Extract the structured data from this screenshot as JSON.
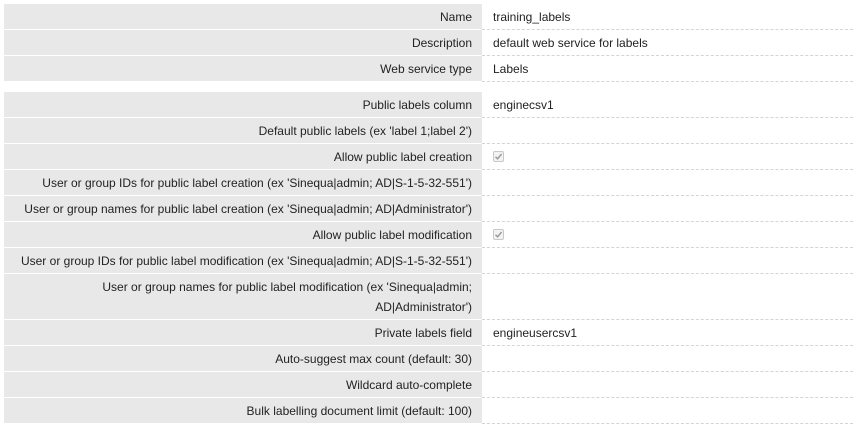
{
  "general": [
    {
      "label": "Name",
      "value": "training_labels"
    },
    {
      "label": "Description",
      "value": "default web service for labels"
    },
    {
      "label": "Web service type",
      "value": "Labels"
    }
  ],
  "settings": [
    {
      "label": "Public labels column",
      "value": "enginecsv1"
    },
    {
      "label": "Default public labels (ex 'label 1;label 2')",
      "value": ""
    },
    {
      "label": "Allow public label creation",
      "checked": true
    },
    {
      "label": "User or group IDs for public label creation (ex 'Sinequa|admin; AD|S-1-5-32-551')",
      "value": ""
    },
    {
      "label": "User or group names for public label creation (ex 'Sinequa|admin; AD|Administrator')",
      "value": ""
    },
    {
      "label": "Allow public label modification",
      "checked": true
    },
    {
      "label": "User or group IDs for public label modification (ex 'Sinequa|admin; AD|S-1-5-32-551')",
      "value": ""
    },
    {
      "label": "User or group names for public label modification (ex 'Sinequa|admin; AD|Administrator')",
      "value": ""
    },
    {
      "label": "Private labels field",
      "value": "engineusercsv1"
    },
    {
      "label": "Auto-suggest max count (default: 30)",
      "value": ""
    },
    {
      "label": "Wildcard auto-complete",
      "value": ""
    },
    {
      "label": "Bulk labelling document limit (default: 100)",
      "value": ""
    }
  ]
}
